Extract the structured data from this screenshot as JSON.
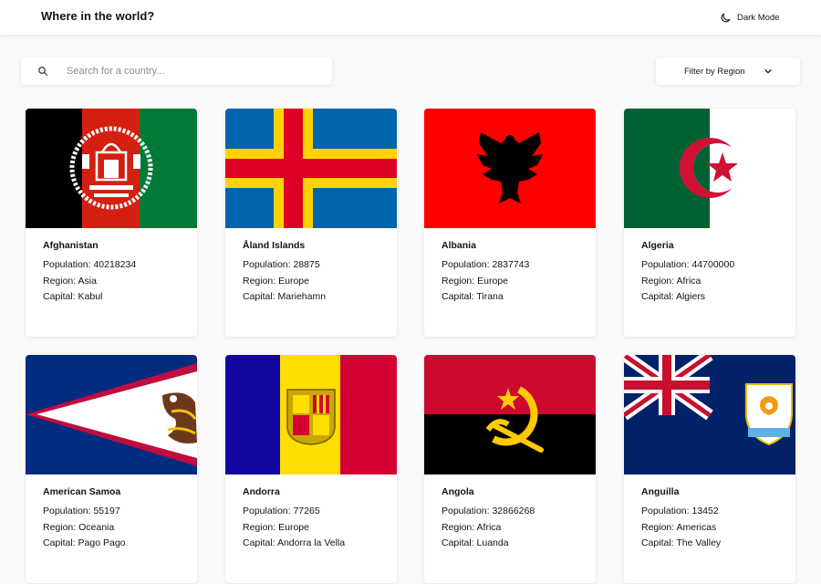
{
  "header": {
    "title": "Where in the world?",
    "dark_mode_label": "Dark Mode",
    "dark_mode_icon": "moon-icon"
  },
  "search": {
    "placeholder": "Search for a country...",
    "value": "",
    "icon": "search-icon"
  },
  "filter": {
    "label": "Filter by Region",
    "icon": "chevron-down-icon"
  },
  "labels": {
    "population": "Population:",
    "region": "Region:",
    "capital": "Capital:"
  },
  "countries": [
    {
      "name": "Afghanistan",
      "population": "40218234",
      "region": "Asia",
      "capital": "Kabul",
      "flag": "afghanistan-flag"
    },
    {
      "name": "Åland Islands",
      "population": "28875",
      "region": "Europe",
      "capital": "Mariehamn",
      "flag": "aland-islands-flag"
    },
    {
      "name": "Albania",
      "population": "2837743",
      "region": "Europe",
      "capital": "Tirana",
      "flag": "albania-flag"
    },
    {
      "name": "Algeria",
      "population": "44700000",
      "region": "Africa",
      "capital": "Algiers",
      "flag": "algeria-flag"
    },
    {
      "name": "American Samoa",
      "population": "55197",
      "region": "Oceania",
      "capital": "Pago Pago",
      "flag": "american-samoa-flag"
    },
    {
      "name": "Andorra",
      "population": "77265",
      "region": "Europe",
      "capital": "Andorra la Vella",
      "flag": "andorra-flag"
    },
    {
      "name": "Angola",
      "population": "32866268",
      "region": "Africa",
      "capital": "Luanda",
      "flag": "angola-flag"
    },
    {
      "name": "Anguilla",
      "population": "13452",
      "region": "Americas",
      "capital": "The Valley",
      "flag": "anguilla-flag"
    }
  ],
  "colors": {
    "background": "#fafafa",
    "surface": "#ffffff",
    "text": "#111517",
    "placeholder": "#8b8b8b"
  }
}
